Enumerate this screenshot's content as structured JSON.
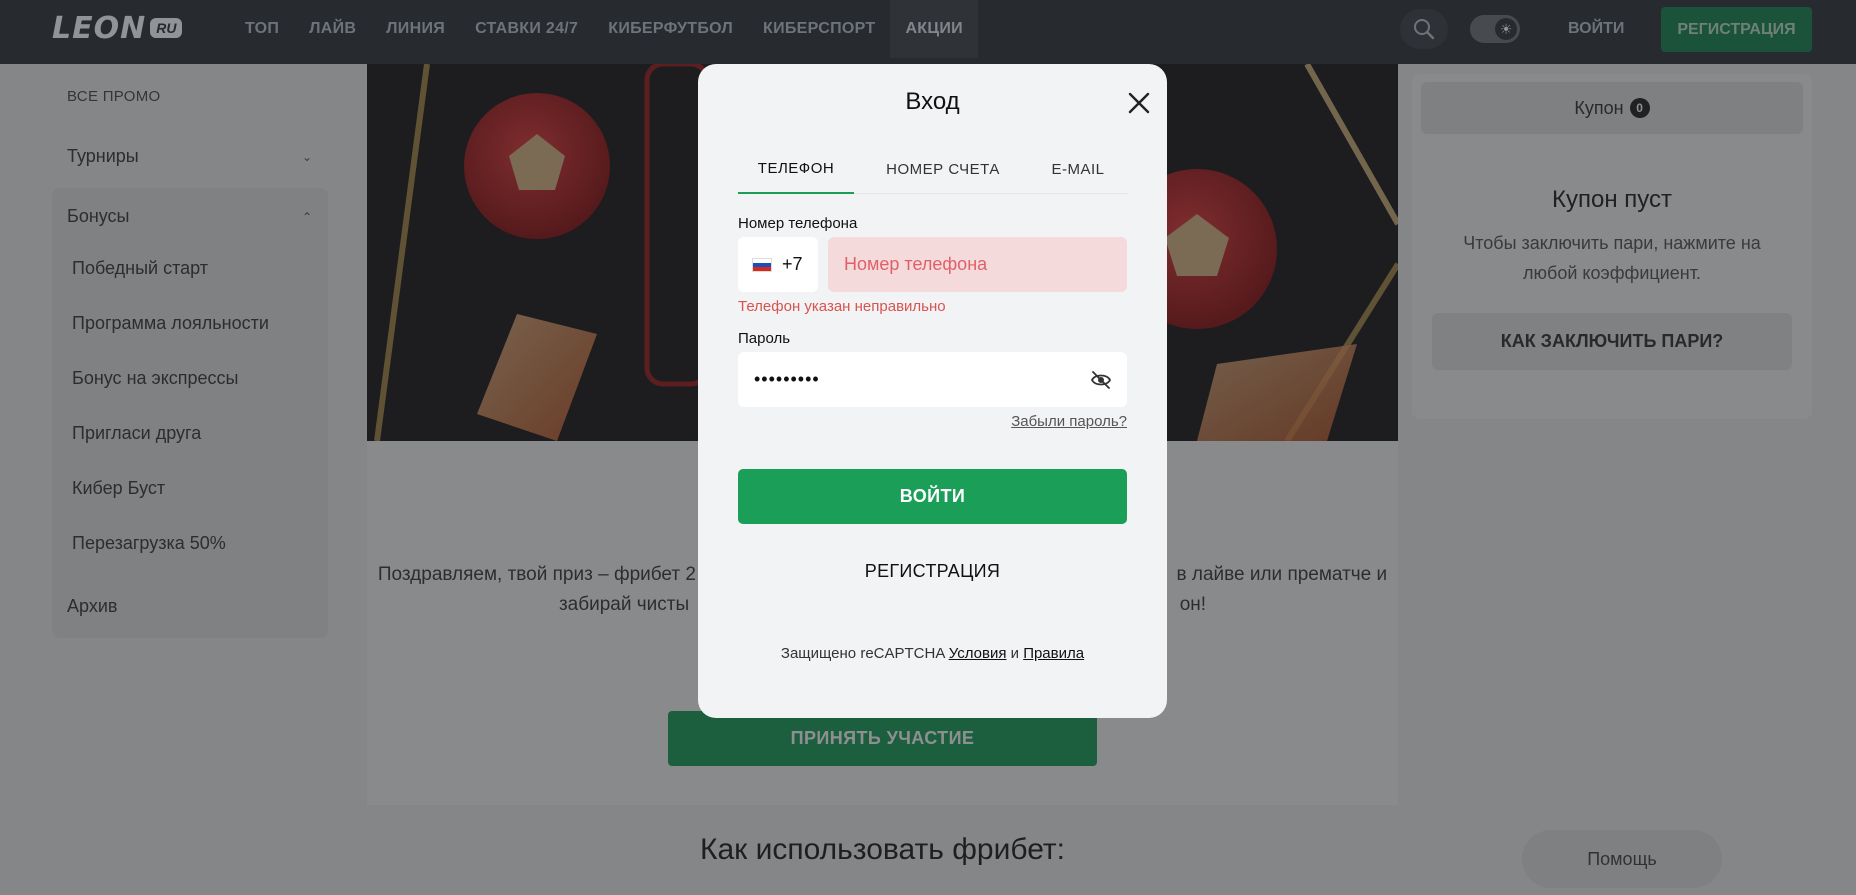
{
  "header": {
    "logo_text": "LEON",
    "logo_suffix": "RU",
    "nav": [
      "ТОП",
      "ЛАЙВ",
      "ЛИНИЯ",
      "СТАВКИ 24/7",
      "КИБЕРФУТБОЛ",
      "КИБЕРСПОРТ",
      "АКЦИИ"
    ],
    "active_nav": "АКЦИИ",
    "login_label": "ВОЙТИ",
    "register_label": "РЕГИСТРАЦИЯ"
  },
  "sidebar": {
    "all_promo": "ВСЕ ПРОМО",
    "tournaments": "Турниры",
    "bonuses": "Бонусы",
    "bonus_items": [
      "Победный старт",
      "Программа лояльности",
      "Бонус на экспрессы",
      "Пригласи друга",
      "Кибер Буст",
      "Перезагрузка 50%"
    ],
    "archive": "Архив"
  },
  "main": {
    "promo_line1": "Поздравляем, твой приз – фрибет 2",
    "promo_line1_end": "в лайве или прематче и",
    "promo_line2": "забирай чисты",
    "promo_line2_end": "он!",
    "participate_label": "ПРИНЯТЬ УЧАСТИЕ",
    "howto_title": "Как использовать фрибет:"
  },
  "coupon": {
    "tab_label": "Купон",
    "count": "0",
    "empty_title": "Купон пуст",
    "empty_desc": "Чтобы заключить пари, нажмите на любой коэффициент.",
    "howto_button": "КАК ЗАКЛЮЧИТЬ ПАРИ?"
  },
  "help_label": "Помощь",
  "login_modal": {
    "title": "Вход",
    "tabs": [
      "ТЕЛЕФОН",
      "НОМЕР СЧЕТА",
      "E-MAIL"
    ],
    "active_tab": "ТЕЛЕФОН",
    "phone_label": "Номер телефона",
    "country_code": "+7",
    "phone_placeholder": "Номер телефона",
    "phone_error": "Телефон указан неправильно",
    "password_label": "Пароль",
    "password_value": "•••••••••",
    "forgot_password": "Забыли пароль?",
    "submit_label": "ВОЙТИ",
    "register_label": "РЕГИСТРАЦИЯ",
    "captcha_text": "Защищено reCAPTCHA",
    "captcha_terms": "Условия",
    "captcha_and": "и",
    "captcha_rules": "Правила"
  },
  "colors": {
    "accent_green": "#1b9e58",
    "header_bg": "#2d3135",
    "error_red": "#d9534f",
    "error_field_bg": "#f5dadb"
  }
}
